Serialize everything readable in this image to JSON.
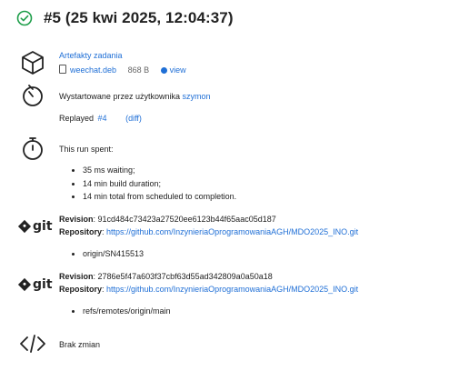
{
  "header": {
    "title": "#5 (25 kwi 2025, 12:04:37)"
  },
  "artifacts": {
    "heading": "Artefakty zadania",
    "file_name": "weechat.deb",
    "file_size": "868 B",
    "view_label": "view"
  },
  "started": {
    "text": "Wystartowane przez użytkownika",
    "user": "szymon"
  },
  "replayed": {
    "text": "Replayed",
    "build": "#4",
    "diff": "(diff)"
  },
  "timing": {
    "heading": "This run spent:",
    "items": [
      "35 ms waiting;",
      "14 min build duration;",
      "14 min total from scheduled to completion."
    ]
  },
  "git1": {
    "revision_label": "Revision",
    "revision": "91cd484c73423a27520ee6123b44f65aac05d187",
    "repo_label": "Repository",
    "repo_url": "https://github.com/InzynieriaOprogramowaniaAGH/MDO2025_INO.git",
    "branch": "origin/SN415513",
    "logo_text": "git"
  },
  "git2": {
    "revision_label": "Revision",
    "revision": "2786e5f47a603f37cbf63d55ad342809a0a50a18",
    "repo_label": "Repository",
    "repo_url": "https://github.com/InzynieriaOprogramowaniaAGH/MDO2025_INO.git",
    "branch": "refs/remotes/origin/main",
    "logo_text": "git"
  },
  "changes": {
    "text": "Brak zmian"
  },
  "colors": {
    "success": "#1e9e4a",
    "link": "#1f6fd6"
  }
}
